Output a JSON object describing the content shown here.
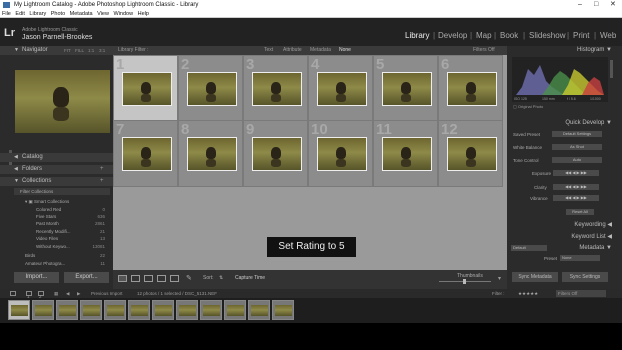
{
  "window": {
    "title": "My Lightroom Catalog - Adobe Photoshop Lightroom Classic - Library",
    "controls": [
      "–",
      "□",
      "✕"
    ]
  },
  "menu": [
    "File",
    "Edit",
    "Library",
    "Photo",
    "Metadata",
    "View",
    "Window",
    "Help"
  ],
  "identity": {
    "logo": "Lr",
    "product": "Adobe Lightroom Classic",
    "user": "Jason Parnell-Brookes"
  },
  "modules": [
    "Library",
    "Develop",
    "Map",
    "Book",
    "Slideshow",
    "Print",
    "Web"
  ],
  "active_module": "Library",
  "left_panel": {
    "navigator": {
      "label": "Navigator",
      "zoom": [
        "FIT",
        "FILL",
        "1:1",
        "3:1"
      ]
    },
    "catalog": "Catalog",
    "folders": "Folders",
    "collections": "Collections",
    "filter_collections": "Filter Collections",
    "smart_collections": "Smart Collections",
    "items": [
      {
        "name": "Colored Red",
        "count": "0"
      },
      {
        "name": "Five Stars",
        "count": "636"
      },
      {
        "name": "Past Month",
        "count": "2861"
      },
      {
        "name": "Recently Modifi...",
        "count": "21"
      },
      {
        "name": "Video Files",
        "count": "13"
      },
      {
        "name": "Without Keywo...",
        "count": "13081"
      },
      {
        "name": "Birds",
        "count": "22"
      },
      {
        "name": "Amateur Photogra...",
        "count": "11"
      }
    ],
    "import_btn": "Import...",
    "export_btn": "Export..."
  },
  "filter_bar": {
    "label": "Library Filter :",
    "options": [
      "Text",
      "Attribute",
      "Metadata",
      "None"
    ],
    "status": "Filters Off"
  },
  "grid": {
    "numbers": [
      "1",
      "2",
      "3",
      "4",
      "5",
      "6",
      "7",
      "8",
      "9",
      "10",
      "11",
      "12"
    ],
    "selected_index": 0
  },
  "toast": "Set Rating to 5",
  "toolbar": {
    "sort_label": "Sort:",
    "sort_value": "Capture Time",
    "thumbnails_label": "Thumbnails"
  },
  "right_panel": {
    "histogram": "Histogram",
    "histo_info": [
      "ISO 125",
      "150 mm",
      "f / 5.6",
      "1/1000"
    ],
    "original_photo": "Original Photo",
    "quick_develop": "Quick Develop",
    "saved_preset_label": "Saved Preset",
    "saved_preset_value": "Default Settings",
    "white_balance_label": "White Balance",
    "white_balance_value": "As Shot",
    "tone_control_label": "Tone Control",
    "tone_control_value": "Auto",
    "exposure": "Exposure",
    "clarity": "Clarity",
    "vibrance": "Vibrance",
    "reset_all": "Reset All",
    "keywording": "Keywording",
    "keyword_list": "Keyword List",
    "metadata": "Metadata",
    "metadata_preset_select": "Default",
    "preset_label": "Preset",
    "preset_value": "None",
    "sync_metadata": "Sync Metadata",
    "sync_settings": "Sync Settings"
  },
  "filmstrip_bar": {
    "pages": [
      "1",
      "2"
    ],
    "source": "Previous Import",
    "info": "12 photos / 1 selected / DSC_5131.NEF",
    "filter_label": "Filter :",
    "filter_status": "Filters Off"
  }
}
